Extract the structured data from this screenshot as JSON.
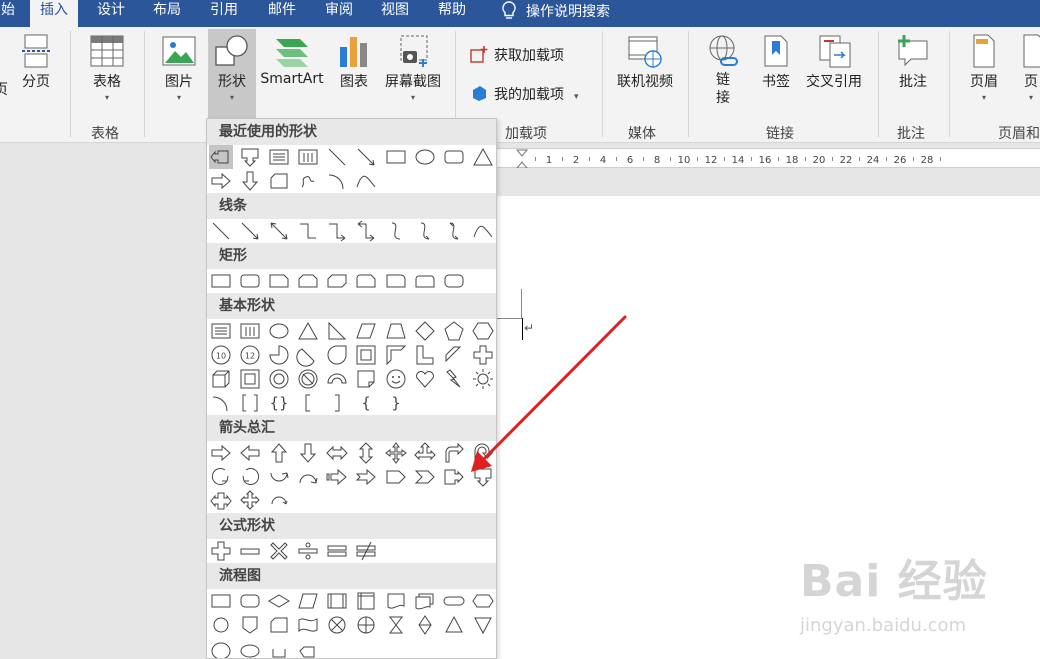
{
  "tabs": [
    {
      "label": "始"
    },
    {
      "label": "插入"
    },
    {
      "label": "设计"
    },
    {
      "label": "布局"
    },
    {
      "label": "引用"
    },
    {
      "label": "邮件"
    },
    {
      "label": "审阅"
    },
    {
      "label": "视图"
    },
    {
      "label": "帮助"
    }
  ],
  "tell_me": "操作说明搜索",
  "ribbon": {
    "page_partial": "页",
    "page_break": "分页",
    "table": "表格",
    "picture": "图片",
    "shapes": "形状",
    "smartart": "SmartArt",
    "chart": "图表",
    "screenshot": "屏幕截图",
    "get_addins": "获取加载项",
    "my_addins": "我的加载项",
    "online_video": "联机视频",
    "link": "链接",
    "bookmark": "书签",
    "cross_ref": "交叉引用",
    "comment": "批注",
    "header": "页眉",
    "footer_partial": "页",
    "groups": {
      "tables": "表格",
      "addins": "加载项",
      "media": "媒体",
      "links": "链接",
      "comments": "批注",
      "header_footer": "页眉和"
    }
  },
  "ruler_labels": [
    "1",
    "2",
    "4",
    "6",
    "8",
    "10",
    "12",
    "14",
    "16",
    "18",
    "20",
    "22",
    "24",
    "26",
    "28"
  ],
  "shapes_menu": {
    "sections": [
      {
        "title": "最近使用的形状"
      },
      {
        "title": "线条"
      },
      {
        "title": "矩形"
      },
      {
        "title": "基本形状"
      },
      {
        "title": "箭头总汇"
      },
      {
        "title": "公式形状"
      },
      {
        "title": "流程图"
      }
    ]
  },
  "watermark": {
    "brand": "Bai 经验",
    "url": "jingyan.baidu.com"
  },
  "colors": {
    "tab_blue": "#2b579a",
    "arrow_red": "#e02020"
  }
}
